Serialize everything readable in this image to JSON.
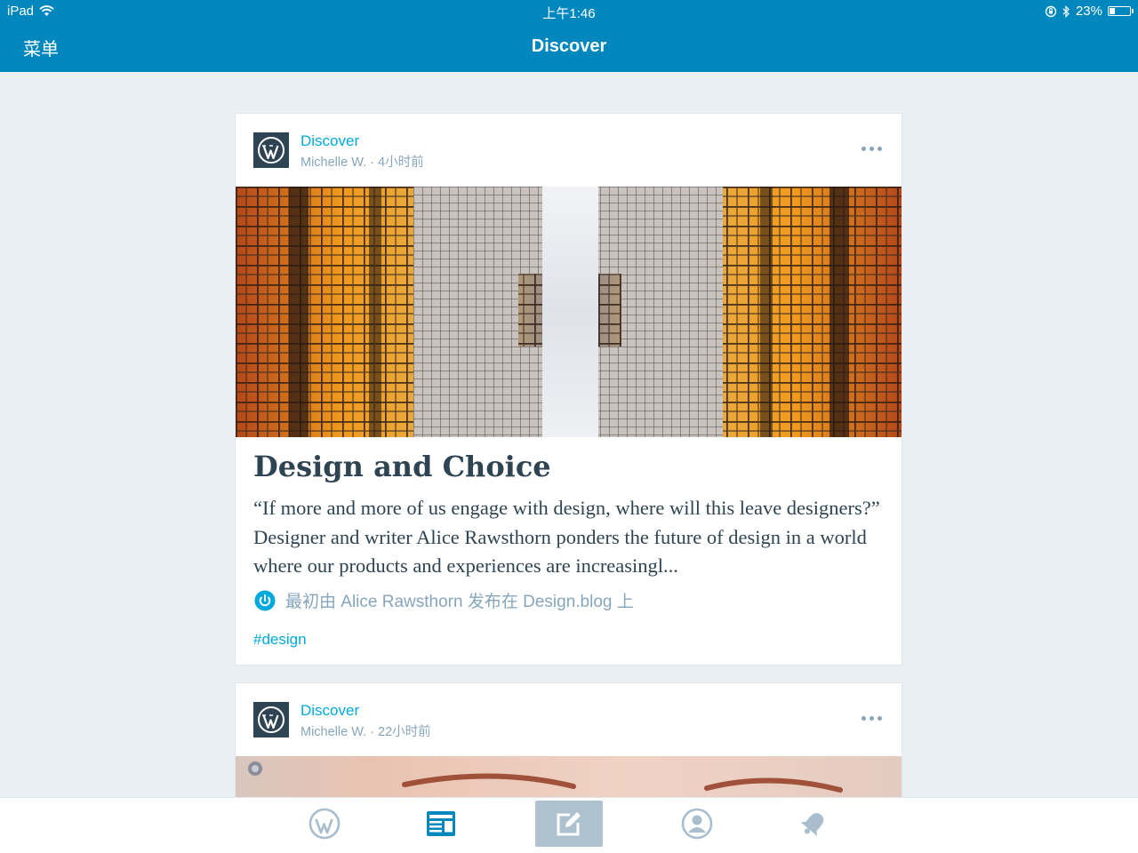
{
  "status_bar": {
    "device": "iPad",
    "time": "上午1:46",
    "battery": "23%",
    "battery_level": 0.23
  },
  "nav": {
    "menu_label": "菜单",
    "title": "Discover"
  },
  "posts": [
    {
      "site": "Discover",
      "byline": "Michelle W. · 4小时前",
      "title": "Design and Choice",
      "excerpt": "“If more and more of us engage with design, where will this leave designers?” Designer and writer Alice Rawsthorn ponders the future of design in a world where our products and experiences are increasingl...",
      "source": "最初由 Alice Rawsthorn 发布在 Design.blog 上",
      "tag": "#design"
    },
    {
      "site": "Discover",
      "byline": "Michelle W. · 22小时前"
    }
  ],
  "tabs": [
    {
      "name": "my-sites",
      "icon": "wordpress-icon"
    },
    {
      "name": "reader",
      "icon": "reader-icon",
      "selected": true
    },
    {
      "name": "write",
      "icon": "write-icon"
    },
    {
      "name": "me",
      "icon": "user-icon"
    },
    {
      "name": "notifications",
      "icon": "bell-icon"
    }
  ],
  "colors": {
    "nav_bar": "#0087be",
    "accent": "#00aadc",
    "text": "#2e4453",
    "meta": "#87a6bc",
    "background": "#e9eff3"
  }
}
